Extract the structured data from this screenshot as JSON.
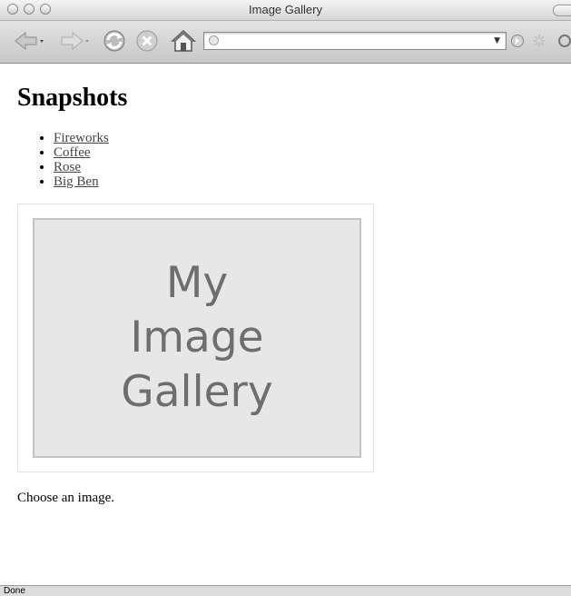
{
  "window": {
    "title": "Image Gallery"
  },
  "toolbar": {
    "back_icon": "back-arrow-icon",
    "forward_icon": "forward-arrow-icon",
    "reload_icon": "reload-icon",
    "stop_icon": "stop-icon",
    "home_icon": "home-icon",
    "url": {
      "value": "",
      "placeholder": ""
    },
    "go_icon": "go-icon",
    "spinner_icon": "spinner-icon"
  },
  "page": {
    "heading": "Snapshots",
    "links": [
      {
        "label": "Fireworks"
      },
      {
        "label": "Coffee"
      },
      {
        "label": "Rose"
      },
      {
        "label": "Big Ben"
      }
    ],
    "placeholder_lines": [
      "My",
      "Image",
      "Gallery"
    ],
    "description": "Choose an image."
  },
  "status": {
    "text": "Done"
  }
}
